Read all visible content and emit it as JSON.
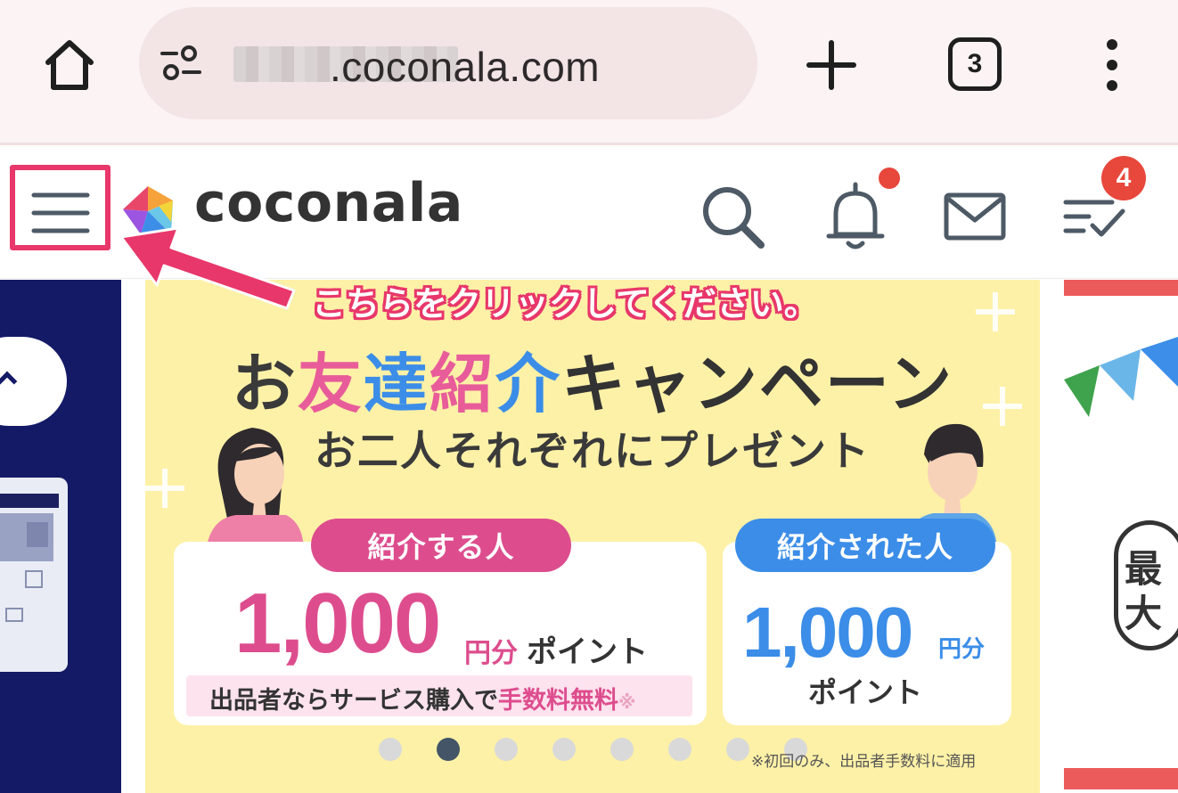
{
  "browser": {
    "url_domain": ".coconala.com",
    "tab_count": "3"
  },
  "header": {
    "logo_text": "coconala",
    "todo_badge_count": "4"
  },
  "annotation": {
    "callout_text": "こちらをクリックしてください。",
    "color": "#e8376a"
  },
  "banner": {
    "title_parts": [
      "お",
      "友",
      "達",
      "紹",
      "介",
      "キャンペーン"
    ],
    "subtitle": "お二人それぞれにプレゼント",
    "referrer": {
      "label": "紹介する人",
      "amount": "1,000",
      "yen_unit": "円分",
      "point_label": "ポイント",
      "fee_text_prefix": "出品者ならサービス購入で",
      "fee_text_emphasis": "手数料無料",
      "fee_mark": "※"
    },
    "referee": {
      "label": "紹介された人",
      "amount": "1,000",
      "yen_unit": "円分",
      "point_label": "ポイント"
    },
    "footnote": "※初回のみ、出品者手数料に適用",
    "carousel": {
      "total": 8,
      "active_index": 1
    }
  },
  "right_banner": {
    "text": "最大"
  },
  "colors": {
    "brand_pink": "#dd4d8e",
    "brand_blue": "#3b8de8",
    "banner_bg": "#fdf1a7",
    "left_banner_bg": "#141a66",
    "notification_red": "#e8473c"
  }
}
